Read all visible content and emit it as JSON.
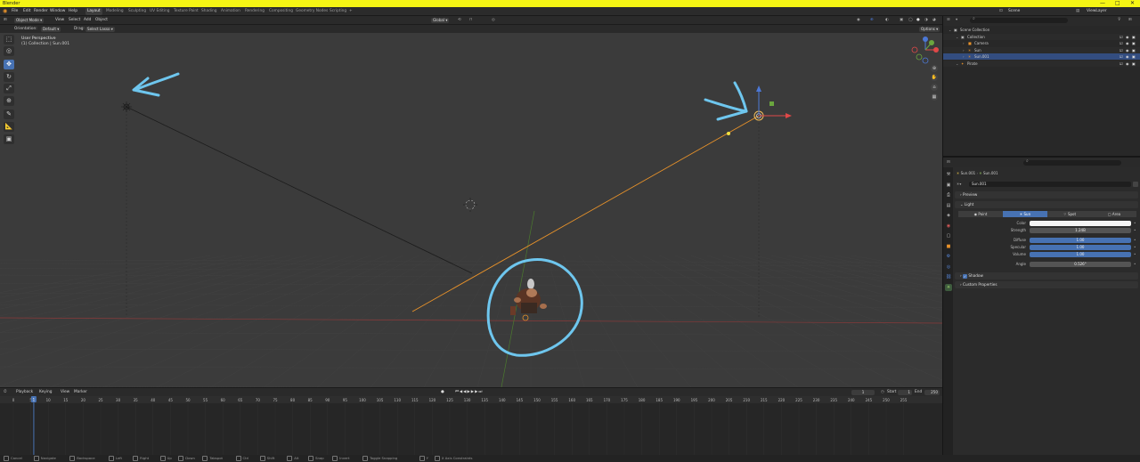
{
  "window": {
    "title": "Blender",
    "controls": [
      "—",
      "□",
      "✕"
    ]
  },
  "menu": {
    "items": [
      "File",
      "Edit",
      "Render",
      "Window",
      "Help"
    ]
  },
  "workspaces": [
    "Layout",
    "Modeling",
    "Sculpting",
    "UV Editing",
    "Texture Paint",
    "Shading",
    "Animation",
    "Rendering",
    "Compositing",
    "Geometry Nodes",
    "Scripting",
    "+"
  ],
  "active_workspace": "Layout",
  "scene": {
    "name": "Scene",
    "view_layer": "ViewLayer"
  },
  "viewport_header": {
    "mode": "Object Mode",
    "menus": [
      "View",
      "Select",
      "Add",
      "Object"
    ],
    "transform": "Global",
    "orientation_label": "Orientation:",
    "orientation": "Default",
    "drag_label": "Drag:",
    "drag": "Select Lasso",
    "options": "Options"
  },
  "viewport": {
    "perspective": "User Perspective",
    "collection": "(1) Collection | Sun.001"
  },
  "toolbar": {
    "tools": [
      {
        "name": "select-box-tool",
        "glyph": "⬚",
        "active": false
      },
      {
        "name": "cursor-tool",
        "glyph": "◎",
        "active": false
      },
      {
        "name": "move-tool",
        "glyph": "✥",
        "active": true
      },
      {
        "name": "rotate-tool",
        "glyph": "↻",
        "active": false
      },
      {
        "name": "scale-tool",
        "glyph": "⤢",
        "active": false
      },
      {
        "name": "transform-tool",
        "glyph": "⊕",
        "active": false
      },
      {
        "name": "annotate-tool",
        "glyph": "✎",
        "active": false
      },
      {
        "name": "measure-tool",
        "glyph": "📐",
        "active": false
      },
      {
        "name": "add-cube-tool",
        "glyph": "▣",
        "active": false
      }
    ]
  },
  "timeline": {
    "menus": [
      "Playback",
      "Keying",
      "View",
      "Marker"
    ],
    "current_frame": "1",
    "start_label": "Start",
    "start": "1",
    "end_label": "End",
    "end": "250",
    "ruler": [
      "0",
      "5",
      "10",
      "15",
      "20",
      "25",
      "30",
      "35",
      "40",
      "45",
      "50",
      "55",
      "60",
      "65",
      "70",
      "75",
      "80",
      "85",
      "90",
      "95",
      "100",
      "105",
      "110",
      "115",
      "120",
      "125",
      "130",
      "135",
      "140",
      "145",
      "150",
      "155",
      "160",
      "165",
      "170",
      "175",
      "180",
      "185",
      "190",
      "195",
      "200",
      "205",
      "210",
      "215",
      "220",
      "225",
      "230",
      "235",
      "240",
      "245",
      "250",
      "255"
    ],
    "playhead": 1
  },
  "outliner": {
    "search_placeholder": "",
    "rows": [
      {
        "label": "Scene Collection",
        "indent": 0,
        "icon": "collection-icon",
        "selected": false
      },
      {
        "label": "Collection",
        "indent": 1,
        "icon": "collection-icon",
        "selected": false
      },
      {
        "label": "Camera",
        "indent": 2,
        "icon": "camera-icon",
        "selected": false
      },
      {
        "label": "Sun",
        "indent": 2,
        "icon": "light-icon",
        "selected": false
      },
      {
        "label": "Sun.001",
        "indent": 2,
        "icon": "light-icon",
        "selected": true
      },
      {
        "label": "Pirate",
        "indent": 1,
        "icon": "armature-icon",
        "selected": false
      }
    ]
  },
  "properties": {
    "breadcrumb": [
      "Sun.001",
      "Sun.001"
    ],
    "datablock": "Sun.001",
    "preview_label": "Preview",
    "light_label": "Light",
    "light_types": [
      "Point",
      "Sun",
      "Spot",
      "Area"
    ],
    "active_light_type": "Sun",
    "fields": [
      {
        "label": "Color",
        "value": "",
        "style": "white"
      },
      {
        "label": "Strength",
        "value": "1.24B",
        "style": "grey"
      },
      {
        "label": "Diffuse",
        "value": "1.00",
        "style": "blue"
      },
      {
        "label": "Specular",
        "value": "1.00",
        "style": "blue"
      },
      {
        "label": "Volume",
        "value": "1.00",
        "style": "blue"
      },
      {
        "label": "Angle",
        "value": "0.526°",
        "style": "grey"
      }
    ],
    "shadow_label": "Shadow",
    "custom_label": "Custom Properties"
  },
  "statusbar": {
    "items": [
      "Cancel",
      "Navigate",
      "Backspace",
      "Left",
      "Right",
      "Up",
      "Down",
      "Tabspot",
      "Ctrl",
      "Shift",
      "Alt",
      "Snap",
      "Invert",
      "Toggle Snapping",
      "Y",
      "X Axis Constraints"
    ]
  },
  "colors": {
    "titlebar": "#f5f514",
    "accent": "#4772b3",
    "annotation": "#6ec6ee",
    "sun_line": "#e8922a",
    "axis_x": "#e04848",
    "axis_y": "#6aa63e",
    "axis_z": "#4c78d6"
  }
}
